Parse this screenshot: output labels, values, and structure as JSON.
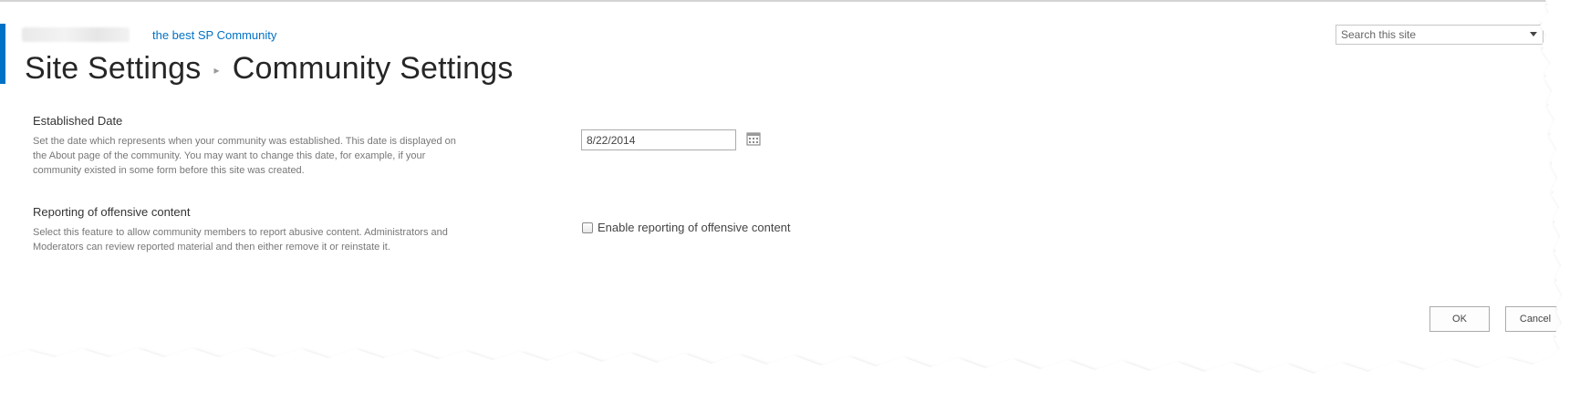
{
  "header": {
    "community_link": "the best SP Community",
    "breadcrumb": {
      "parent": "Site Settings",
      "current": "Community Settings"
    }
  },
  "search": {
    "placeholder": "Search this site"
  },
  "sections": {
    "established_date": {
      "title": "Established Date",
      "description": "Set the date which represents when your community was established. This date is displayed on the About page of the community. You may want to change this date, for example, if your community existed in some form before this site was created.",
      "value": "8/22/2014"
    },
    "offensive_content": {
      "title": "Reporting of offensive content",
      "description": "Select this feature to allow community members to report abusive content. Administrators and Moderators can review reported material and then either remove it or reinstate it.",
      "checkbox_label": "Enable reporting of offensive content",
      "checked": false
    }
  },
  "buttons": {
    "ok": "OK",
    "cancel": "Cancel"
  },
  "colors": {
    "accent": "#0072c6",
    "title": "#262626"
  },
  "icons": {
    "search": "magnifier-icon",
    "calendar": "calendar-icon",
    "dropdown": "chevron-down-icon"
  }
}
